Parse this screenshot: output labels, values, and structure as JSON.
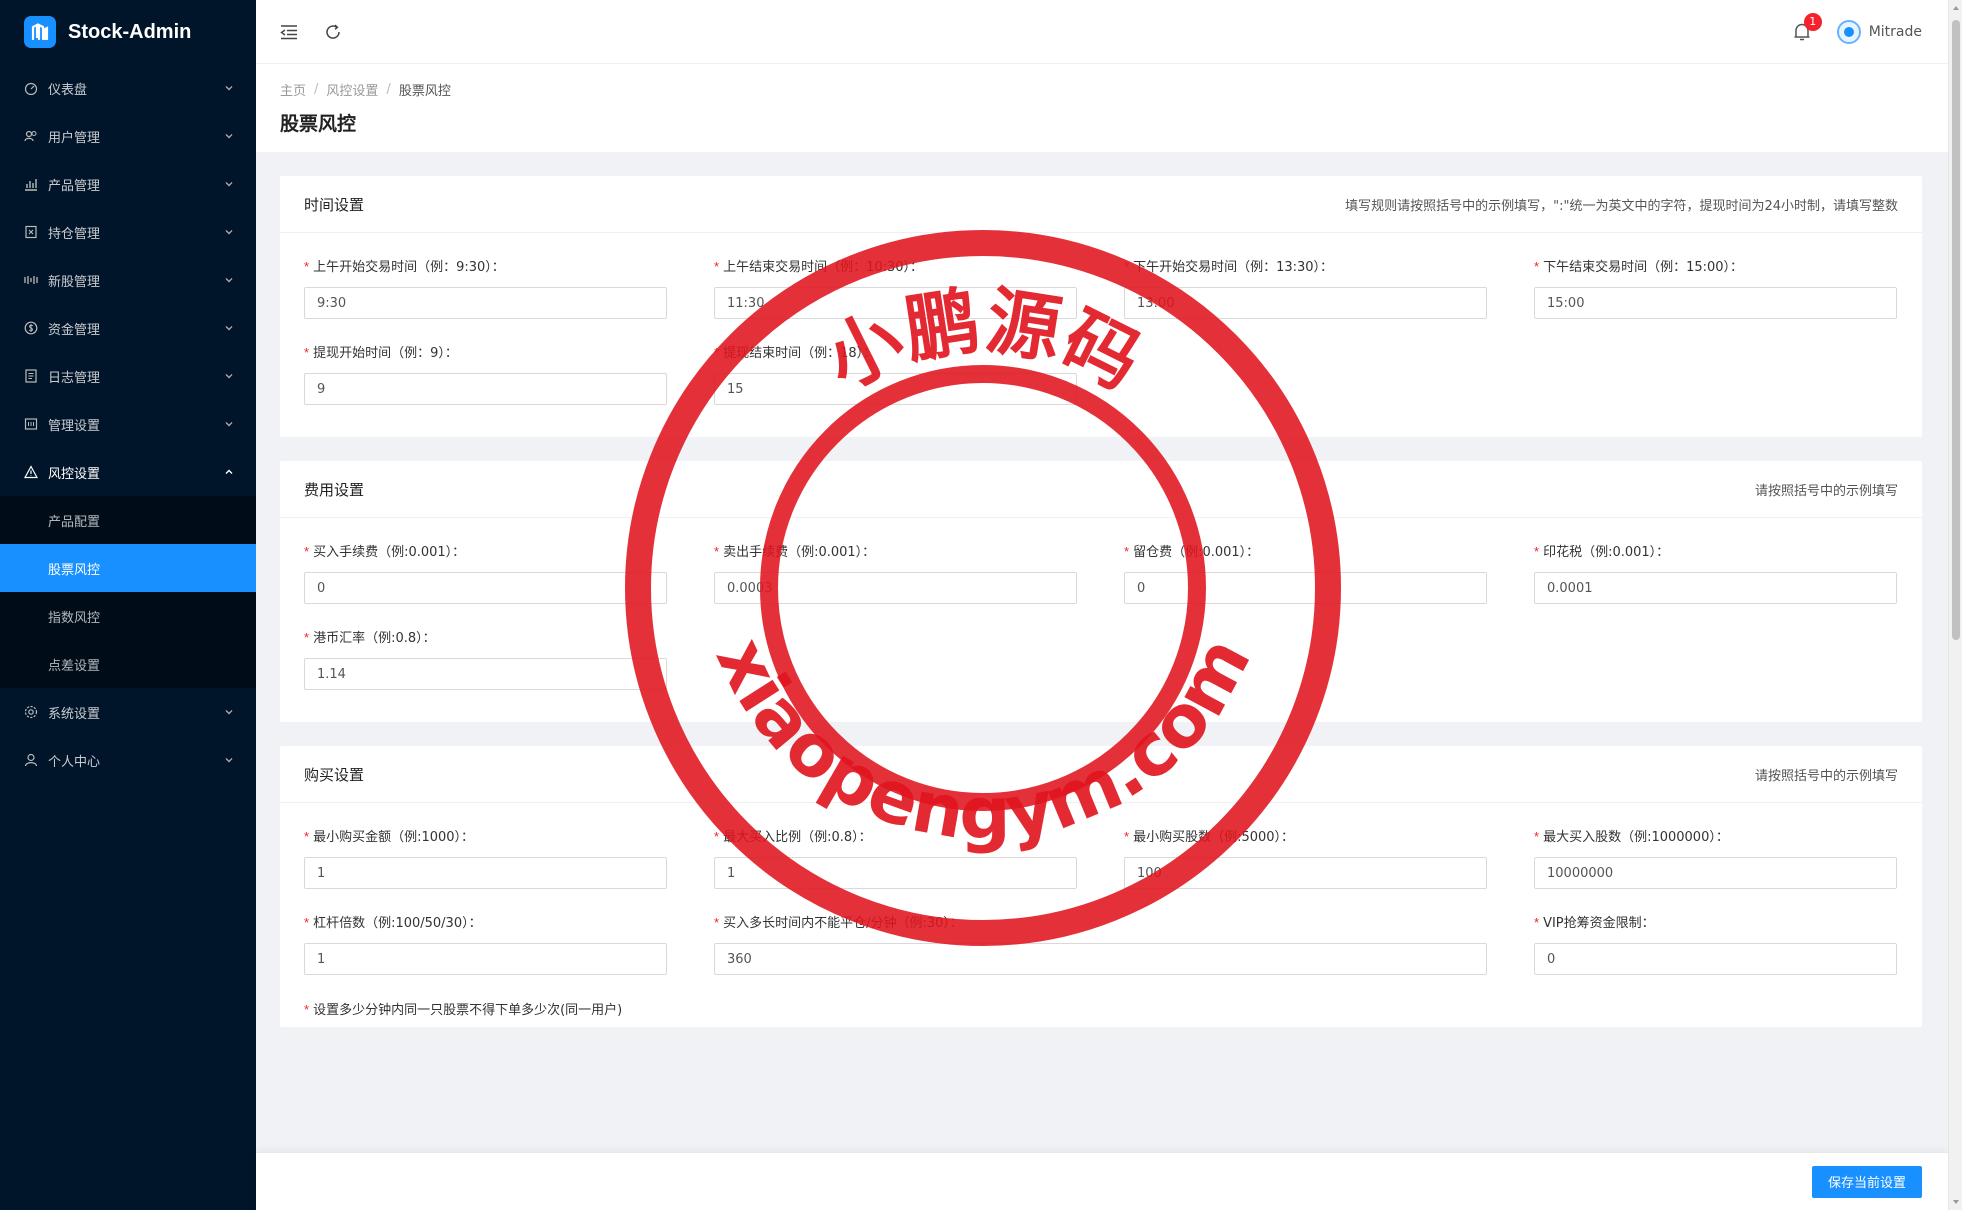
{
  "app": {
    "title": "Stock-Admin"
  },
  "sidebar": {
    "items": [
      {
        "label": "仪表盘",
        "icon": "dashboard-icon"
      },
      {
        "label": "用户管理",
        "icon": "users-icon"
      },
      {
        "label": "产品管理",
        "icon": "chart-icon"
      },
      {
        "label": "持仓管理",
        "icon": "position-icon"
      },
      {
        "label": "新股管理",
        "icon": "ipo-icon"
      },
      {
        "label": "资金管理",
        "icon": "money-icon"
      },
      {
        "label": "日志管理",
        "icon": "log-icon"
      },
      {
        "label": "管理设置",
        "icon": "admin-icon"
      },
      {
        "label": "风控设置",
        "icon": "warning-icon"
      },
      {
        "label": "系统设置",
        "icon": "gear-icon"
      },
      {
        "label": "个人中心",
        "icon": "user-icon"
      }
    ],
    "sub": [
      {
        "label": "产品配置"
      },
      {
        "label": "股票风控"
      },
      {
        "label": "指数风控"
      },
      {
        "label": "点差设置"
      }
    ]
  },
  "header": {
    "notification_count": "1",
    "username": "Mitrade"
  },
  "breadcrumb": {
    "home": "主页",
    "parent": "风控设置",
    "current": "股票风控"
  },
  "page": {
    "title": "股票风控"
  },
  "sections": {
    "time": {
      "title": "时间设置",
      "hint": "填写规则请按照括号中的示例填写，\":\"统一为英文中的字符，提现时间为24小时制，请填写整数",
      "f1": {
        "label": "上午开始交易时间（例：9:30）：",
        "value": "9:30"
      },
      "f2": {
        "label": "上午结束交易时间（例：10:30）：",
        "value": "11:30"
      },
      "f3": {
        "label": "下午开始交易时间（例：13:30）：",
        "value": "13:00"
      },
      "f4": {
        "label": "下午结束交易时间（例：15:00）：",
        "value": "15:00"
      },
      "f5": {
        "label": "提现开始时间（例：9）：",
        "value": "9"
      },
      "f6": {
        "label": "提现结束时间（例：18）：",
        "value": "15"
      }
    },
    "fee": {
      "title": "费用设置",
      "hint": "请按照括号中的示例填写",
      "f1": {
        "label": "买入手续费（例:0.001）：",
        "value": "0"
      },
      "f2": {
        "label": "卖出手续费（例:0.001）：",
        "value": "0.0003"
      },
      "f3": {
        "label": "留仓费（例:0.001）：",
        "value": "0"
      },
      "f4": {
        "label": "印花税（例:0.001）：",
        "value": "0.0001"
      },
      "f5": {
        "label": "港币汇率（例:0.8）：",
        "value": "1.14"
      }
    },
    "buy": {
      "title": "购买设置",
      "hint": "请按照括号中的示例填写",
      "f1": {
        "label": "最小购买金额（例:1000）：",
        "value": "1"
      },
      "f2": {
        "label": "最大买入比例（例:0.8）：",
        "value": "1"
      },
      "f3": {
        "label": "最小购买股数（例:5000）：",
        "value": "100"
      },
      "f4": {
        "label": "最大买入股数（例:1000000）：",
        "value": "10000000"
      },
      "f5": {
        "label": "杠杆倍数（例:100/50/30）：",
        "value": "1"
      },
      "f6": {
        "label": "买入多长时间内不能平仓/分钟（例:30）：",
        "value": "360"
      },
      "f7": {
        "label": "VIP抢筹资金限制：",
        "value": "0"
      },
      "cut": "设置多少分钟内同一只股票不得下单多少次(同一用户)"
    }
  },
  "footer": {
    "save_label": "保存当前设置"
  },
  "watermark": {
    "cn": "小鹏源码",
    "en": "xiaopengym.com",
    "color": "#e0141e"
  }
}
